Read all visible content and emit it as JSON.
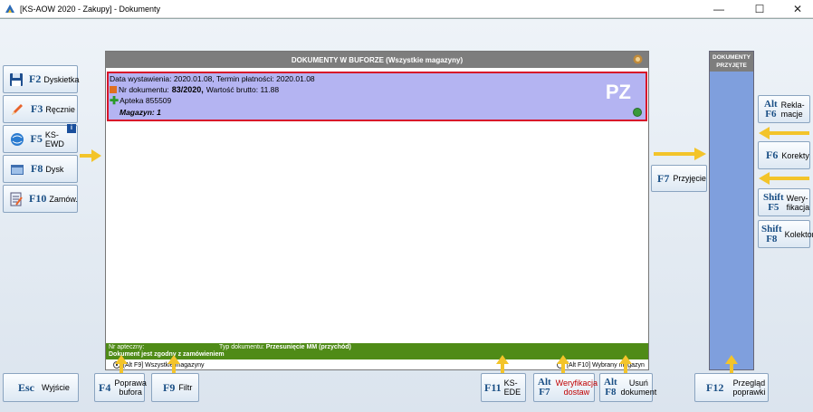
{
  "window": {
    "title": "[KS-AOW 2020 - Zakupy] - Dokumenty",
    "minimize": "—",
    "maximize": "☐",
    "close": "✕"
  },
  "left_buttons": [
    {
      "key": "F2",
      "label": "Dyskietka",
      "icon": "floppy-icon"
    },
    {
      "key": "F3",
      "label": "Ręcznie",
      "icon": "pencil-icon"
    },
    {
      "key": "F5",
      "label": "KS-EWD",
      "icon": "globe-icon"
    },
    {
      "key": "F8",
      "label": "Dysk",
      "icon": "folder-icon"
    },
    {
      "key": "F10",
      "label": "Zamów.",
      "icon": "order-icon"
    }
  ],
  "panel": {
    "title": "DOKUMENTY W BUFORZE (Wszystkie magazyny)",
    "document": {
      "dates": "Data wystawienia: 2020.01.08, Termin płatności: 2020.01.08",
      "number_label": "Nr dokumentu:",
      "number_value": "83/2020,",
      "gross_label": "Wartość brutto: 11.88",
      "supplier": "Apteka 855509",
      "warehouse": "Magazyn: 1",
      "type_badge": "PZ"
    },
    "status": {
      "pharmacy_no": "Nr apteczny:",
      "doc_type_label": "Typ dokumentu:",
      "doc_type_value": "Przesunięcie MM (przychód)",
      "message": "Dokument jest zgodny z zamówieniem"
    },
    "radio_all": "[Alt F9] Wszystkie magazyny",
    "radio_selected": "[Alt F10] Wybrany magazyn"
  },
  "accepted_panel": {
    "title_line1": "DOKUMENTY",
    "title_line2": "PRZYJĘTE"
  },
  "middle_button": {
    "key": "F7",
    "label": "Przyjęcie"
  },
  "right_buttons": [
    {
      "key1": "Alt",
      "key2": "F6",
      "label1": "Rekla-",
      "label2": "macje"
    },
    {
      "key1": "F6",
      "key2": "",
      "label1": "Korekty",
      "label2": ""
    },
    {
      "key1": "Shift",
      "key2": "F5",
      "label1": "Wery-",
      "label2": "fikacja"
    },
    {
      "key1": "Shift",
      "key2": "F8",
      "label1": "Kolektor",
      "label2": ""
    }
  ],
  "bottom_buttons": {
    "esc": {
      "key": "Esc",
      "label": "Wyjście"
    },
    "f4": {
      "key": "F4",
      "label1": "Poprawa",
      "label2": "bufora"
    },
    "f9": {
      "key": "F9",
      "label": "Filtr"
    },
    "f11": {
      "key": "F11",
      "label": "KS-EDE"
    },
    "alt_f7": {
      "key1": "Alt",
      "key2": "F7",
      "label1": "Weryfikacja",
      "label2": "dostaw"
    },
    "alt_f8": {
      "key1": "Alt",
      "key2": "F8",
      "label1": "Usuń",
      "label2": "dokument"
    },
    "f12": {
      "key": "F12",
      "label1": "Przegląd",
      "label2": "poprawki"
    }
  },
  "colors": {
    "accent_key": "#1a4f85",
    "document_bg": "#b4b4f2",
    "document_border": "#d8152a",
    "status_bg": "#4f8b17",
    "accepted_bg": "#7f9fdd",
    "arrow": "#f3c42a"
  }
}
